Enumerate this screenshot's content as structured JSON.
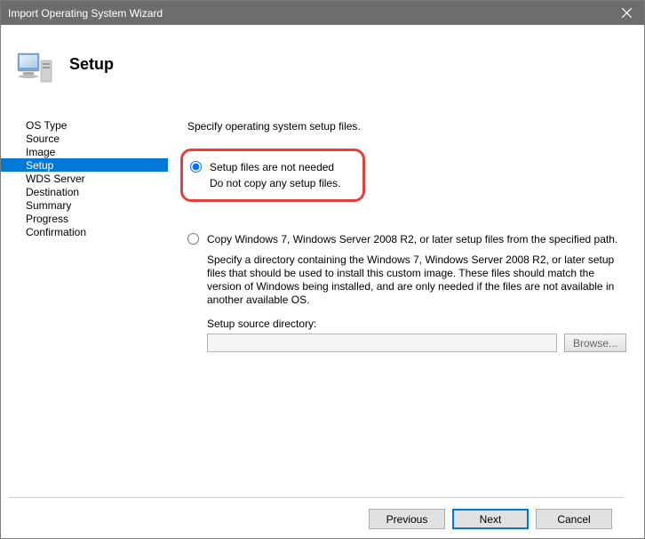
{
  "titlebar": {
    "title": "Import Operating System Wizard"
  },
  "header": {
    "heading": "Setup"
  },
  "sidebar": {
    "items": [
      {
        "label": "OS Type"
      },
      {
        "label": "Source"
      },
      {
        "label": "Image"
      },
      {
        "label": "Setup"
      },
      {
        "label": "WDS Server"
      },
      {
        "label": "Destination"
      },
      {
        "label": "Summary"
      },
      {
        "label": "Progress"
      },
      {
        "label": "Confirmation"
      }
    ],
    "selected": "Setup"
  },
  "content": {
    "heading": "Specify operating system setup files.",
    "option_not_needed": {
      "label": "Setup files are not needed",
      "desc": "Do not copy any setup files."
    },
    "option_copy": {
      "label": "Copy Windows 7, Windows Server 2008 R2, or later setup files from the specified path.",
      "desc": "Specify a directory containing the Windows 7, Windows Server 2008 R2, or later setup files that should be used to install this custom image.  These files should match the version of Windows being installed, and are only needed if the files are not available in another available OS.",
      "dir_label": "Setup source directory:",
      "dir_value": "",
      "browse_label": "Browse..."
    }
  },
  "footer": {
    "previous": "Previous",
    "next": "Next",
    "cancel": "Cancel"
  }
}
